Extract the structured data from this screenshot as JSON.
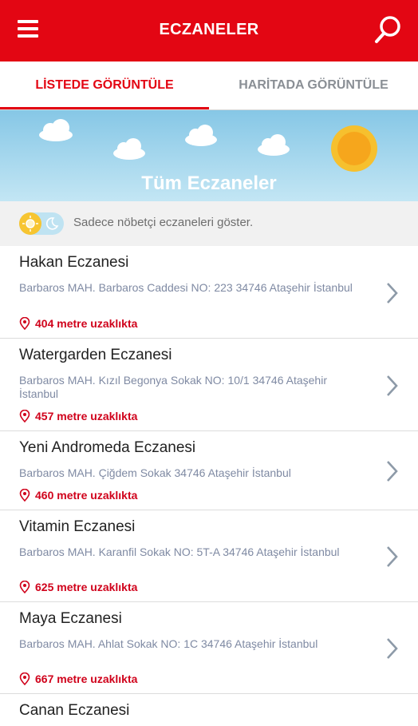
{
  "appbar": {
    "title": "ECZANELER",
    "menu_icon": "menu-icon",
    "search_icon": "search-icon",
    "color": "#e30613"
  },
  "tabs": [
    {
      "label": "LİSTEDE GÖRÜNTÜLE",
      "active": true
    },
    {
      "label": "HARİTADA GÖRÜNTÜLE",
      "active": false
    }
  ],
  "banner": {
    "title": "Tüm Eczaneler"
  },
  "filter": {
    "label": "Sadece nöbetçi eczaneleri göster.",
    "toggle_on": false
  },
  "pharmacies": [
    {
      "name": "Hakan Eczanesi",
      "address": "Barbaros MAH. Barbaros Caddesi NO: 223 34746 Ataşehir İstanbul",
      "distance": "404 metre uzaklıkta"
    },
    {
      "name": "Watergarden Eczanesi",
      "address": "Barbaros MAH. Kızıl Begonya Sokak NO: 10/1 34746 Ataşehir İstanbul",
      "distance": "457 metre uzaklıkta"
    },
    {
      "name": "Yeni Andromeda Eczanesi",
      "address": "Barbaros MAH. Çiğdem Sokak 34746 Ataşehir İstanbul",
      "distance": "460 metre uzaklıkta"
    },
    {
      "name": "Vitamin Eczanesi",
      "address": "Barbaros MAH. Karanfil Sokak NO: 5T-A 34746 Ataşehir İstanbul",
      "distance": "625 metre uzaklıkta"
    },
    {
      "name": "Maya Eczanesi",
      "address": "Barbaros MAH. Ahlat Sokak NO: 1C 34746 Ataşehir İstanbul",
      "distance": "667 metre uzaklıkta"
    },
    {
      "name": "Canan Eczanesi"
    }
  ]
}
